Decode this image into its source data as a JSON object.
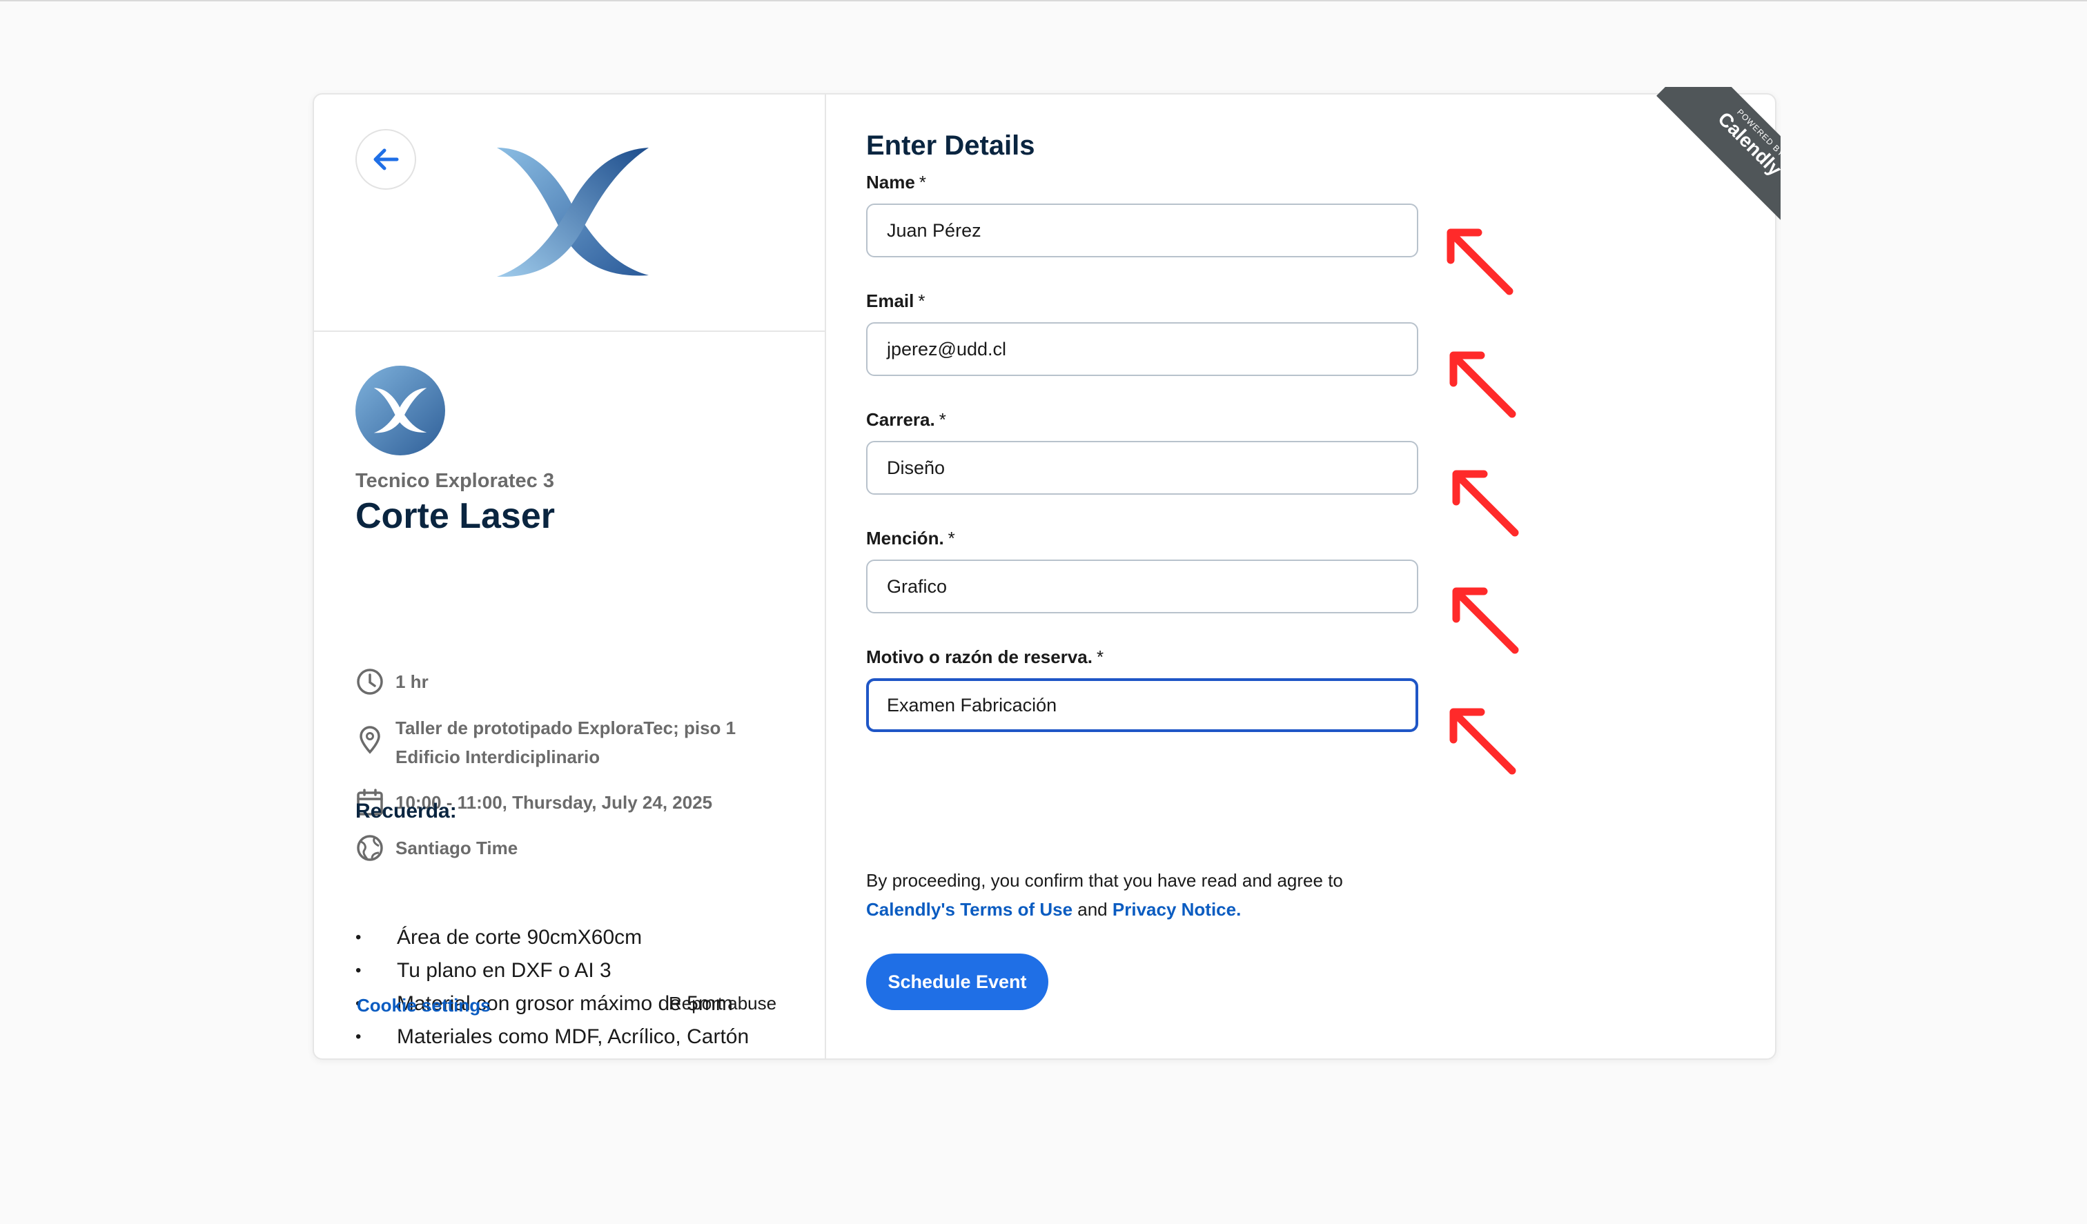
{
  "event": {
    "organizer": "Tecnico Exploratec 3",
    "name": "Corte Laser",
    "duration": "1 hr",
    "location_line1": "Taller de prototipado ExploraTec; piso 1",
    "location_line2": "Edificio Interdiciplinario",
    "datetime": "10:00 - 11:00, Thursday, July 24, 2025",
    "timezone": "Santiago Time",
    "notes_title": "Recuerda:",
    "notes": [
      "Área de corte 90cmX60cm",
      "Tu plano en DXF o AI 3",
      "Material con grosor máximo de 5mm",
      "Materiales como MDF, Acrílico, Cartón"
    ]
  },
  "footer": {
    "cookie_settings": "Cookie settings",
    "report_abuse": "Report abuse"
  },
  "form": {
    "title": "Enter Details",
    "required_marker": "*",
    "fields": [
      {
        "label": "Name",
        "value": "Juan Pérez"
      },
      {
        "label": "Email",
        "value": "jperez@udd.cl"
      },
      {
        "label": "Carrera.",
        "value": "Diseño"
      },
      {
        "label": "Mención.",
        "value": "Grafico"
      },
      {
        "label": "Motivo o razón de reserva.",
        "value": "Examen Fabricación"
      }
    ],
    "legal_prefix": "By proceeding, you confirm that you have read and agree to",
    "terms_link": "Calendly's Terms of Use",
    "legal_and": "and",
    "privacy_link": "Privacy Notice.",
    "submit_label": "Schedule Event"
  },
  "ribbon": {
    "powered_by": "POWERED BY",
    "brand": "Calendly"
  },
  "colors": {
    "brand_blue": "#1f6fe6",
    "link_blue": "#0b5cc1",
    "annotation_red": "#ff2a2a"
  }
}
